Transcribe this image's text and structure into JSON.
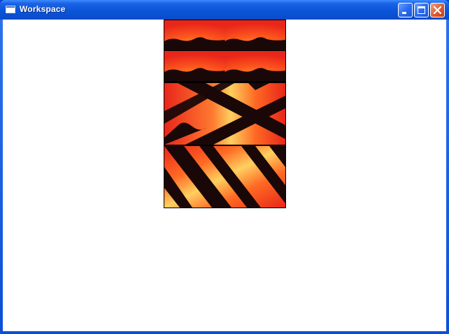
{
  "window": {
    "title": "Workspace",
    "controls": {
      "minimize_icon": "minimize-icon",
      "maximize_icon": "maximize-icon",
      "close_icon": "close-icon"
    }
  },
  "colors": {
    "titlebar": "#0a55d8",
    "client_background": "#ffffff",
    "sunset_orange": "#ff5a1e",
    "sunset_glow": "#ffe46a",
    "silhouette": "#1a0808"
  },
  "image_tiles": [
    {
      "name": "tile-repeat-grid",
      "tile_mode": "tile"
    },
    {
      "name": "tile-rotated-stripes",
      "tile_mode": "rotated"
    },
    {
      "name": "tile-diagonal-stripes",
      "tile_mode": "diagonal"
    }
  ]
}
